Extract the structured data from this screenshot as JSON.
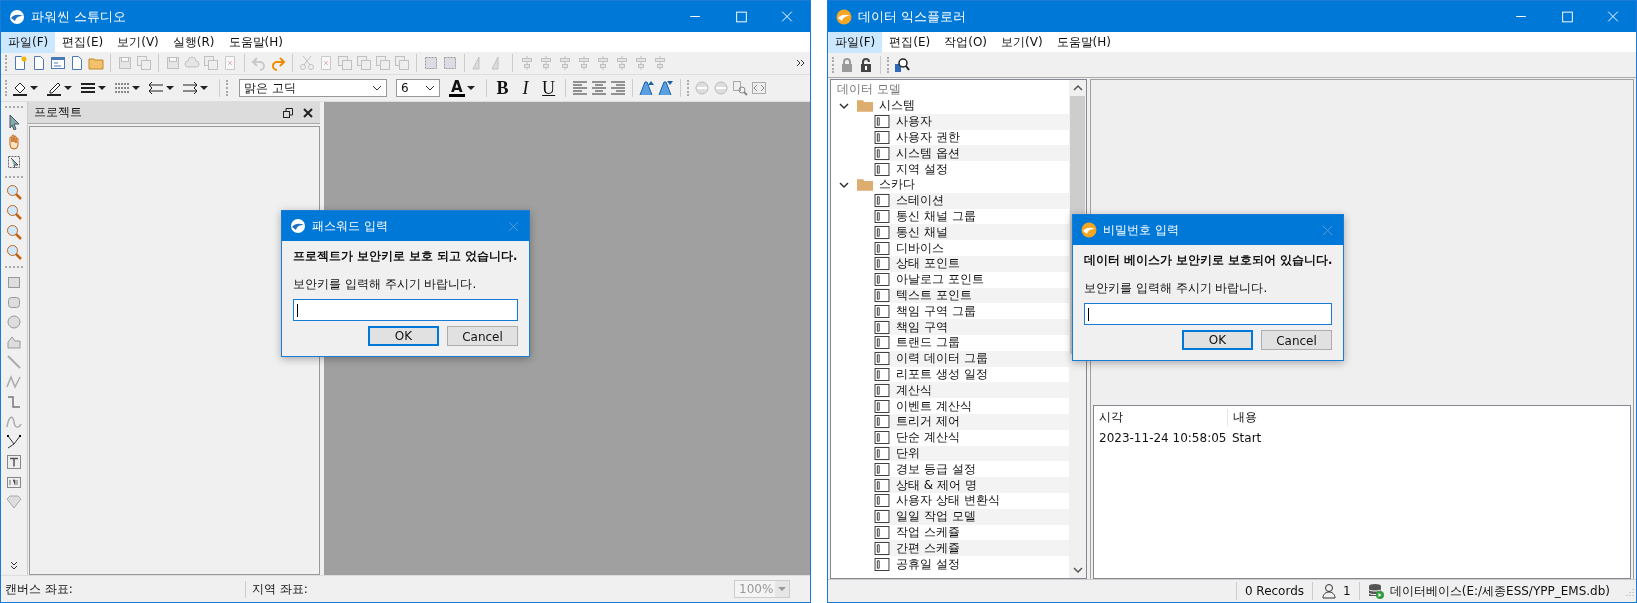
{
  "studio": {
    "title": "파워씬 스튜디오",
    "menu": [
      {
        "label": "파일(F)",
        "selected": true
      },
      {
        "label": "편집(E)",
        "selected": false
      },
      {
        "label": "보기(V)",
        "selected": false
      },
      {
        "label": "실행(R)",
        "selected": false
      },
      {
        "label": "도움말(H)",
        "selected": false
      }
    ],
    "format_bar": {
      "font": "맑은 고딕",
      "size": "6",
      "font_color": "A",
      "styles": [
        "B",
        "I",
        "U"
      ]
    },
    "panel": {
      "title": "프로젝트"
    },
    "status_bar": {
      "canvas": "캔버스 좌표:",
      "region": "지역 좌표:",
      "zoom": "100%",
      "zoom_disabled": true
    },
    "dialog": {
      "title": "패스워드 입력",
      "message": "프로젝트가 보안키로 보호 되고 었습니다.",
      "prompt": "보안키를 입력해 주시기 바랍니다.",
      "ok": "OK",
      "cancel": "Cancel"
    }
  },
  "explorer": {
    "title": "데이터 익스플로러",
    "menu": [
      {
        "label": "파일(F)",
        "selected": true
      },
      {
        "label": "편집(E)",
        "selected": false
      },
      {
        "label": "작업(O)",
        "selected": false
      },
      {
        "label": "보기(V)",
        "selected": false
      },
      {
        "label": "도움말(H)",
        "selected": false
      }
    ],
    "tree": {
      "title": "데이터 모델",
      "items": [
        {
          "label": "시스템",
          "expanded": true,
          "children": [
            {
              "label": "사용자"
            },
            {
              "label": "사용자 권한"
            },
            {
              "label": "시스템 옵션"
            },
            {
              "label": "지역 설정"
            }
          ]
        },
        {
          "label": "스카다",
          "expanded": true,
          "children": [
            {
              "label": "스테이션"
            },
            {
              "label": "통신 채널 그룹"
            },
            {
              "label": "통신 채널"
            },
            {
              "label": "디바이스"
            },
            {
              "label": "상태 포인트"
            },
            {
              "label": "아날로그 포인트"
            },
            {
              "label": "텍스트 포인트"
            },
            {
              "label": "책임 구역 그룹"
            },
            {
              "label": "책임 구역"
            },
            {
              "label": "트랜드 그룹"
            },
            {
              "label": "이력 데이터 그룹"
            },
            {
              "label": "리포트 생성 일정"
            },
            {
              "label": "계산식"
            },
            {
              "label": "이벤트 계산식"
            },
            {
              "label": "트리거 제어"
            },
            {
              "label": "단순 계산식"
            },
            {
              "label": "단위"
            },
            {
              "label": "경보 등급 설정"
            },
            {
              "label": "상태 & 제어 명"
            },
            {
              "label": "사용자 상태 변환식"
            },
            {
              "label": "일일 작업 모델"
            },
            {
              "label": "작업 스케쥴"
            },
            {
              "label": "간편 스케쥴"
            },
            {
              "label": "공휴일 설정"
            }
          ]
        }
      ]
    },
    "log": {
      "columns": [
        "시각",
        "내용"
      ],
      "rows": [
        [
          "2023-11-24 10:58:05",
          "Start"
        ]
      ]
    },
    "status_bar": {
      "records": "0 Records",
      "users": "1",
      "database": "데이터베이스(E:/세종ESS/YPP_EMS.db)"
    },
    "dialog": {
      "title": "비밀번호 입력",
      "message": "데이터 베이스가 보안키로 보호되어 있습니다.",
      "prompt": "보안키를 입력해 주시기 바랍니다.",
      "ok": "OK",
      "cancel": "Cancel"
    }
  }
}
